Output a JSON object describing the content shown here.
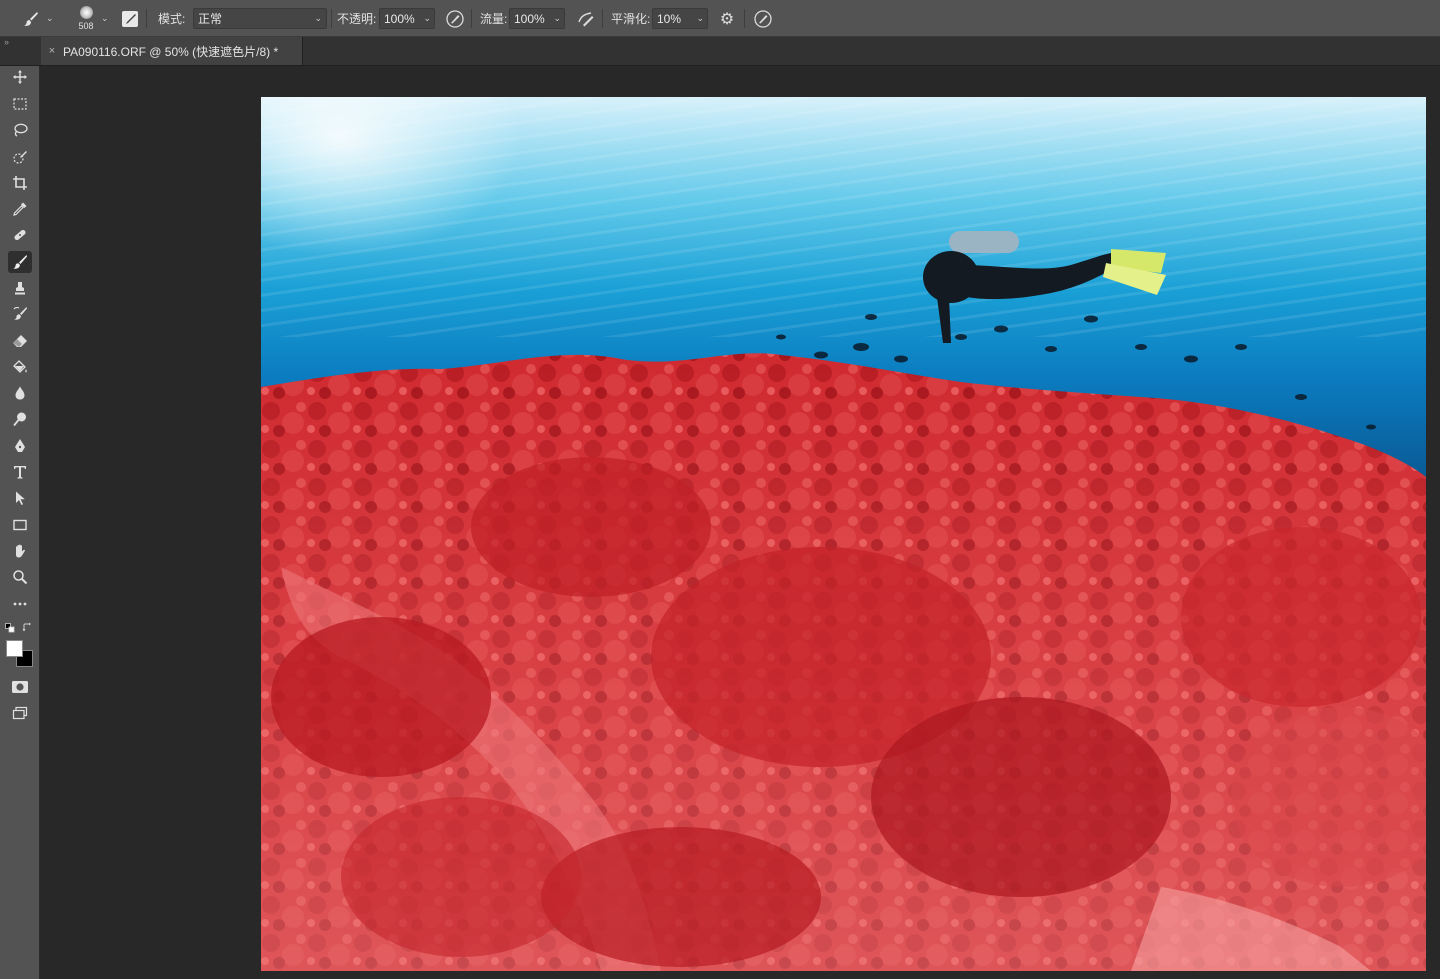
{
  "options_bar": {
    "brush_size": "508",
    "mode_label": "模式:",
    "mode_value": "正常",
    "opacity_label": "不透明:",
    "opacity_value": "100%",
    "flow_label": "流量:",
    "flow_value": "100%",
    "smoothing_label": "平滑化:",
    "smoothing_value": "10%"
  },
  "document_tab": {
    "close_glyph": "×",
    "title": "PA090116.ORF @ 50% (快速遮色片/8) *"
  },
  "toolbar": {
    "collapse_glyph": "››",
    "active_tool": "brush-tool",
    "foreground_color": "#ffffff",
    "background_color": "#000000"
  },
  "canvas": {
    "mask_color": "#d3222a",
    "image_subject": "scuba diver over coral reef"
  },
  "colors": {
    "options_bar_bg": "#535353",
    "tab_bar_bg": "#323232",
    "workspace_bg": "#282828",
    "toolbar_bg": "#535353"
  }
}
